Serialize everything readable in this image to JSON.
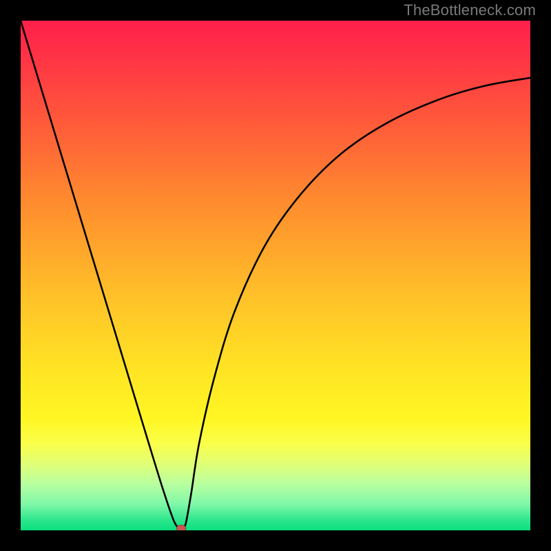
{
  "watermark": "TheBottleneck.com",
  "chart_data": {
    "type": "line",
    "title": "",
    "xlabel": "",
    "ylabel": "",
    "x_range": [
      0,
      1
    ],
    "y_range": [
      0,
      1
    ],
    "annotations": [],
    "background_gradient": {
      "direction": "top-to-bottom",
      "stops": [
        {
          "pos": 0.0,
          "color": "#ff1f4b"
        },
        {
          "pos": 0.2,
          "color": "#ff5a3a"
        },
        {
          "pos": 0.55,
          "color": "#ffc328"
        },
        {
          "pos": 0.78,
          "color": "#fff623"
        },
        {
          "pos": 0.91,
          "color": "#b7ffa0"
        },
        {
          "pos": 1.0,
          "color": "#08df7e"
        }
      ]
    },
    "series": [
      {
        "name": "bottleneck-curve",
        "x": [
          0.0,
          0.05,
          0.1,
          0.15,
          0.2,
          0.25,
          0.28,
          0.3,
          0.31,
          0.315,
          0.32,
          0.325,
          0.335,
          0.35,
          0.38,
          0.42,
          0.48,
          0.55,
          0.63,
          0.72,
          0.82,
          0.91,
          1.0
        ],
        "y": [
          1.0,
          0.835,
          0.67,
          0.505,
          0.34,
          0.175,
          0.078,
          0.02,
          0.004,
          0.0,
          0.004,
          0.018,
          0.075,
          0.17,
          0.3,
          0.43,
          0.56,
          0.66,
          0.74,
          0.8,
          0.845,
          0.872,
          0.888
        ]
      }
    ],
    "minimum_marker": {
      "x": 0.315,
      "y": 0.0,
      "color": "#c9574e"
    }
  }
}
